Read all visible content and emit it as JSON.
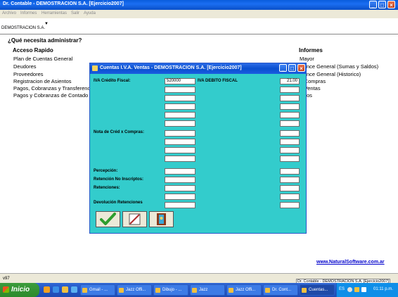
{
  "main_window": {
    "title": "Dr. Contable - DEMOSTRACION S.A.  [Ejercicio2007]"
  },
  "menu": [
    "Archivo",
    "Informes",
    "Herramientas",
    "Salir",
    "Ayuda"
  ],
  "company_selector": {
    "value": "DEMOSTRACION S.A."
  },
  "question": "¿Qué necesita administrar?",
  "quick_access": {
    "title": "Acceso Rapido",
    "items": [
      "Plan de Cuentas General",
      "Deudores",
      "Proveedores",
      "Registracion de Asientos",
      "Pagos, Cobranzas y Transferenc",
      "Pagos y Cobranzas de Contado"
    ]
  },
  "reports": {
    "title": "Informes",
    "items": [
      "Mayor",
      "alance General (Sumas y Saldos)",
      "alance General (Historico)",
      "A Compras",
      "A Ventas",
      "iarios"
    ]
  },
  "website_link": "www.NaturalSoftware.com.ar",
  "status": {
    "left": "v97",
    "right": "Dr. Contable - DEMOSTRACION S.A.  [Ejercicio2007]"
  },
  "dialog": {
    "title": "Cuentas I.V.A. Ventas - DEMOSTRACION S.A.  [Ejercicio2007]",
    "labels": {
      "neto_gravado": "IVA Crédito Fiscal:",
      "iva_debito": "IVA DEBITO FISCAL",
      "nota_credito": "Nota de Créd x Compras:",
      "percepcion": "Percepción:",
      "retencion_no_insc": "Retención No Inscriptos:",
      "retenciones": "Retenciones:",
      "devolucion_ret": "Devolución Retenciones"
    },
    "values": {
      "neto_gravado": "520000",
      "iva_rate": "21.00"
    }
  },
  "taskbar": {
    "start_label": "Inicio",
    "items": [
      "Gmail - ...",
      "Jazz Offi...",
      "Dibujo - ...",
      "Jazz",
      "Jazz Offi...",
      "Dr. Cont...",
      "Cuentas..."
    ],
    "tray_lang": "ES",
    "tray_time": "01:11 p.m."
  }
}
